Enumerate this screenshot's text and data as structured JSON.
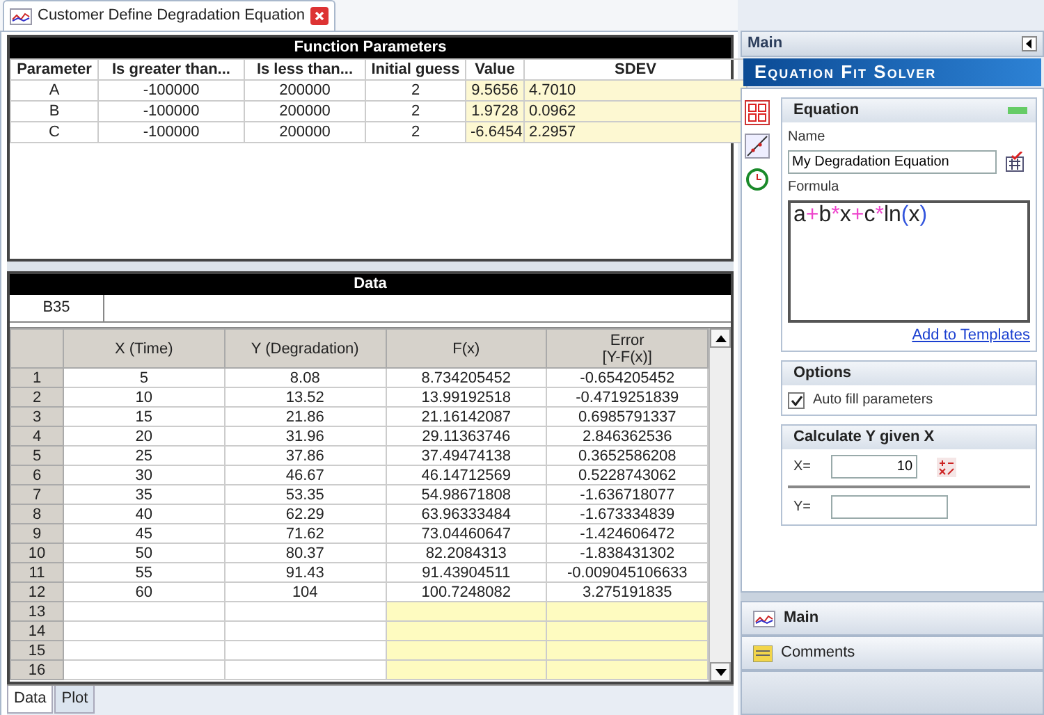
{
  "document_tab": {
    "title": "Customer Define Degradation Equation"
  },
  "function_parameters": {
    "title": "Function Parameters",
    "columns": [
      {
        "label": "Parameter",
        "highlight": false
      },
      {
        "label": "Is greater than...",
        "highlight": false
      },
      {
        "label": "Is less than...",
        "highlight": false
      },
      {
        "label": "Initial guess",
        "highlight": false
      },
      {
        "label": "Value",
        "highlight": true
      },
      {
        "label": "SDEV",
        "highlight": true
      }
    ],
    "rows": [
      [
        "A",
        "-100000",
        "200000",
        "2",
        "9.5656",
        "4.7010"
      ],
      [
        "B",
        "-100000",
        "200000",
        "2",
        "1.9728",
        "0.0962"
      ],
      [
        "C",
        "-100000",
        "200000",
        "2",
        "-6.6454",
        "2.2957"
      ]
    ]
  },
  "data": {
    "title": "Data",
    "cell_ref": "B35",
    "columns": [
      {
        "label": "X (Time)",
        "computed": false
      },
      {
        "label": "Y (Degradation)",
        "computed": false
      },
      {
        "label": "F(x)",
        "computed": true
      },
      {
        "label": "Error\n[Y-F(x)]",
        "computed": true
      }
    ],
    "rows": [
      {
        "n": "1",
        "cells": [
          "5",
          "8.08",
          "8.734205452",
          "-0.654205452"
        ]
      },
      {
        "n": "2",
        "cells": [
          "10",
          "13.52",
          "13.99192518",
          "-0.4719251839"
        ]
      },
      {
        "n": "3",
        "cells": [
          "15",
          "21.86",
          "21.16142087",
          "0.6985791337"
        ]
      },
      {
        "n": "4",
        "cells": [
          "20",
          "31.96",
          "29.11363746",
          "2.846362536"
        ]
      },
      {
        "n": "5",
        "cells": [
          "25",
          "37.86",
          "37.49474138",
          "0.3652586208"
        ]
      },
      {
        "n": "6",
        "cells": [
          "30",
          "46.67",
          "46.14712569",
          "0.5228743062"
        ]
      },
      {
        "n": "7",
        "cells": [
          "35",
          "53.35",
          "54.98671808",
          "-1.636718077"
        ]
      },
      {
        "n": "8",
        "cells": [
          "40",
          "62.29",
          "63.96333484",
          "-1.673334839"
        ]
      },
      {
        "n": "9",
        "cells": [
          "45",
          "71.62",
          "73.04460647",
          "-1.424606472"
        ]
      },
      {
        "n": "10",
        "cells": [
          "50",
          "80.37",
          "82.2084313",
          "-1.838431302"
        ]
      },
      {
        "n": "11",
        "cells": [
          "55",
          "91.43",
          "91.43904511",
          "-0.009045106633"
        ]
      },
      {
        "n": "12",
        "cells": [
          "60",
          "104",
          "100.7248082",
          "3.275191835"
        ]
      },
      {
        "n": "13",
        "cells": []
      },
      {
        "n": "14",
        "cells": []
      },
      {
        "n": "15",
        "cells": []
      },
      {
        "n": "16",
        "cells": []
      }
    ]
  },
  "bottom_tabs": [
    {
      "label": "Data",
      "selected": true
    },
    {
      "label": "Plot",
      "selected": false
    }
  ],
  "side_panel": {
    "title": "Main",
    "banner": "Equation Fit Solver",
    "equation": {
      "title": "Equation",
      "name_label": "Name",
      "name_value": "My Degradation Equation",
      "formula_label": "Formula",
      "formula": [
        {
          "kind": "operand",
          "text": "a"
        },
        {
          "kind": "operator",
          "text": "+"
        },
        {
          "kind": "operand",
          "text": "b"
        },
        {
          "kind": "operator",
          "text": "*"
        },
        {
          "kind": "operand",
          "text": "x"
        },
        {
          "kind": "operator",
          "text": "+"
        },
        {
          "kind": "operand",
          "text": "c"
        },
        {
          "kind": "operator",
          "text": "*"
        },
        {
          "kind": "operand",
          "text": "ln"
        },
        {
          "kind": "paren",
          "text": "("
        },
        {
          "kind": "operand",
          "text": "x"
        },
        {
          "kind": "paren",
          "text": ")"
        }
      ],
      "link": "Add to Templates"
    },
    "options": {
      "title": "Options",
      "auto_fill": {
        "label": "Auto fill parameters",
        "checked": true
      }
    },
    "calculate": {
      "title": "Calculate Y given X",
      "x_label": "X=",
      "x_value": "10",
      "y_label": "Y="
    },
    "nav": [
      {
        "label": "Main",
        "kind": "main"
      },
      {
        "label": "Comments",
        "kind": "comments"
      }
    ]
  }
}
